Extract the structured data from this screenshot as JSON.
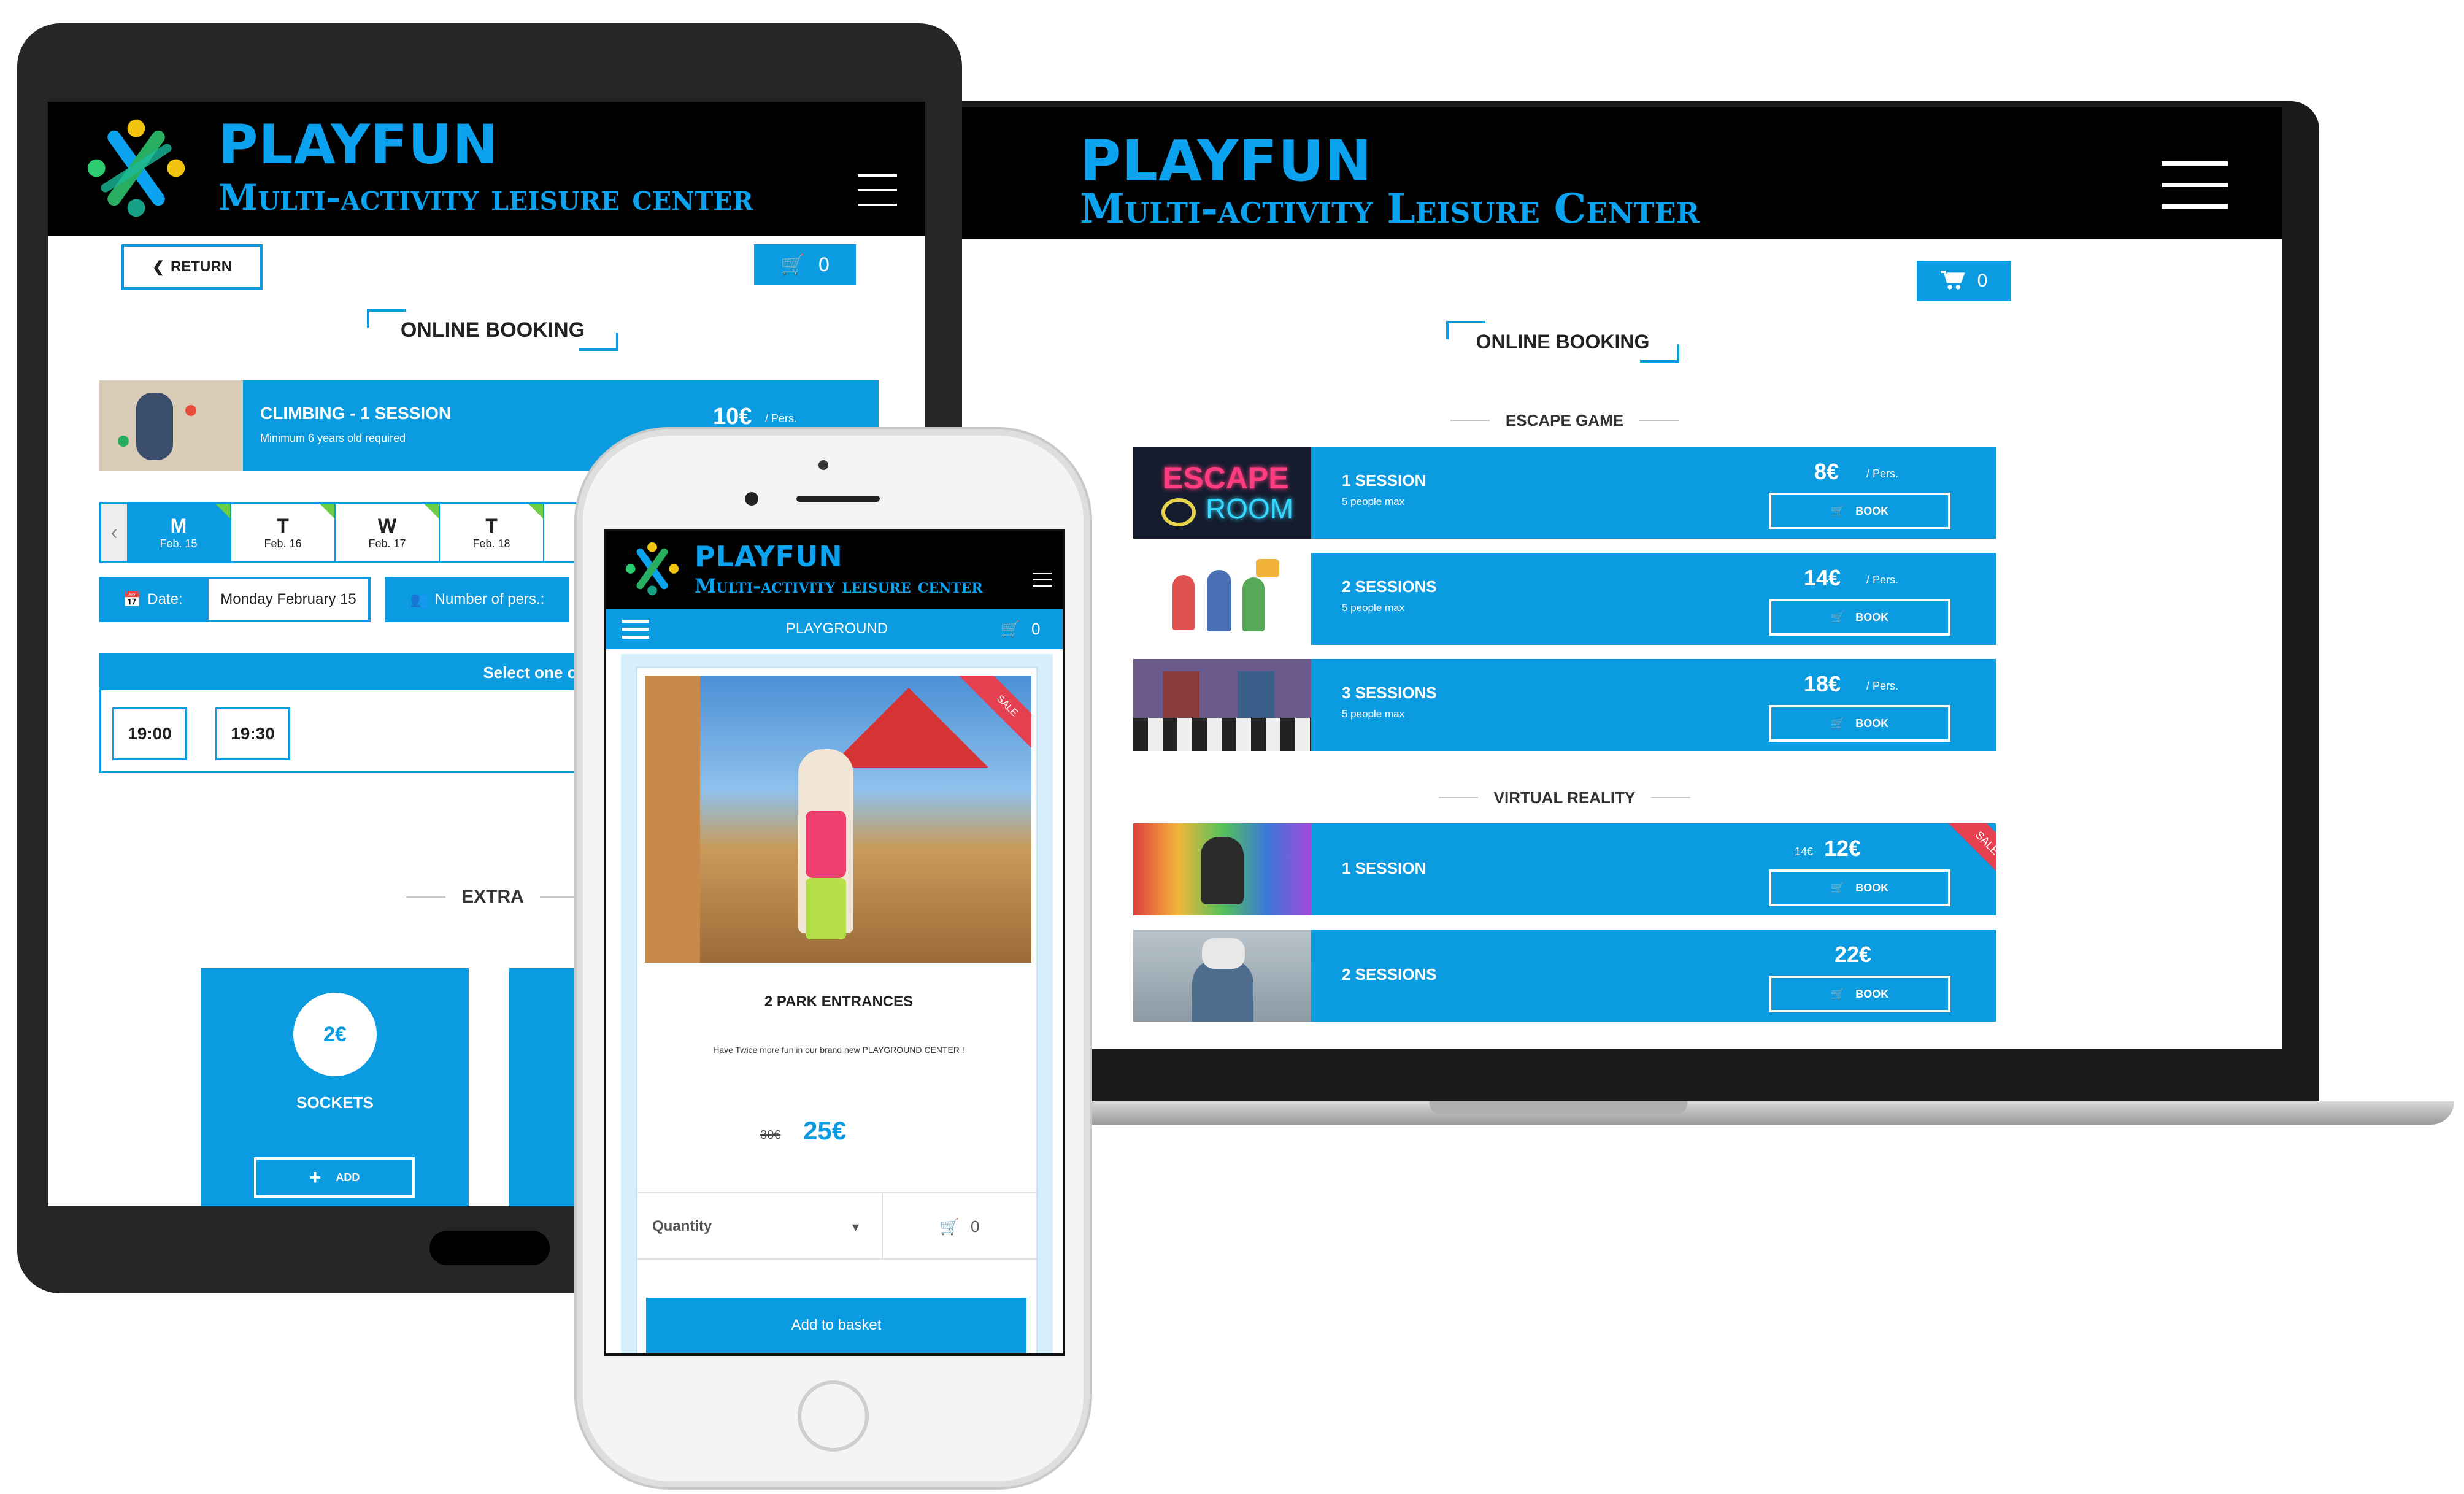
{
  "brand": {
    "name": "PLAYFUN",
    "subtitle_desktop": "Multi-activity Leisure Center",
    "subtitle_tablet": "Multi-activity leisure center",
    "subtitle_phone": "Multi-activity leisure center",
    "colors": {
      "accent": "#0b9be0",
      "header_bg": "#000000",
      "title": "#0ba3ef"
    }
  },
  "laptop": {
    "cart_count": "0",
    "heading": "ONLINE BOOKING",
    "sections": [
      {
        "title": "ESCAPE GAME",
        "items": [
          {
            "name": "1 SESSION",
            "note": "5 people max",
            "price": "8€",
            "unit": "/ Pers.",
            "book": "BOOK",
            "image": "escape-room-neon"
          },
          {
            "name": "2 SESSIONS",
            "note": "5 people max",
            "price": "14€",
            "unit": "/ Pers.",
            "book": "BOOK",
            "image": "group-puzzle"
          },
          {
            "name": "3 SESSIONS",
            "note": "5 people max",
            "price": "18€",
            "unit": "/ Pers.",
            "book": "BOOK",
            "image": "escape-room-lobby"
          }
        ]
      },
      {
        "title": "VIRTUAL REALITY",
        "items": [
          {
            "name": "1 SESSION",
            "old_price": "14€",
            "price": "12€",
            "book": "BOOK",
            "badge": "SALE",
            "image": "vr-colorful"
          },
          {
            "name": "2 SESSIONS",
            "price": "22€",
            "book": "BOOK",
            "image": "vr-headset"
          }
        ]
      }
    ],
    "logo_text": "PLAYFUN",
    "logo_sub": "Multi-activity Leisure Center"
  },
  "tablet": {
    "return_label": "RETURN",
    "cart_count": "0",
    "heading": "ONLINE BOOKING",
    "activity": {
      "title": "CLIMBING - 1 SESSION",
      "note": "Minimum 6 years old required",
      "price": "10€",
      "unit": "/ Pers."
    },
    "days": [
      {
        "letter": "M",
        "date": "Feb. 15",
        "selected": true
      },
      {
        "letter": "T",
        "date": "Feb. 16",
        "selected": false
      },
      {
        "letter": "W",
        "date": "Feb. 17",
        "selected": false
      },
      {
        "letter": "T",
        "date": "Feb. 18",
        "selected": false
      }
    ],
    "date_label": "Date:",
    "date_value": "Monday February 15",
    "persons_label": "Number of pers.:",
    "start_prompt": "Select one or more start",
    "times": [
      "19:00",
      "19:30"
    ],
    "extra_title": "EXTRA",
    "extra_items": [
      {
        "price": "2€",
        "name": "SOCKETS",
        "add": "ADD"
      }
    ]
  },
  "phone": {
    "nav_title": "PLAYGROUND",
    "cart_count": "0",
    "badge": "SALE",
    "product_title": "2 PARK ENTRANCES",
    "product_desc": "Have Twice more fun in our brand new PLAYGROUND CENTER !",
    "old_price": "30€",
    "price": "25€",
    "quantity_label": "Quantity",
    "qty_cart_count": "0",
    "add_label": "Add to basket"
  }
}
